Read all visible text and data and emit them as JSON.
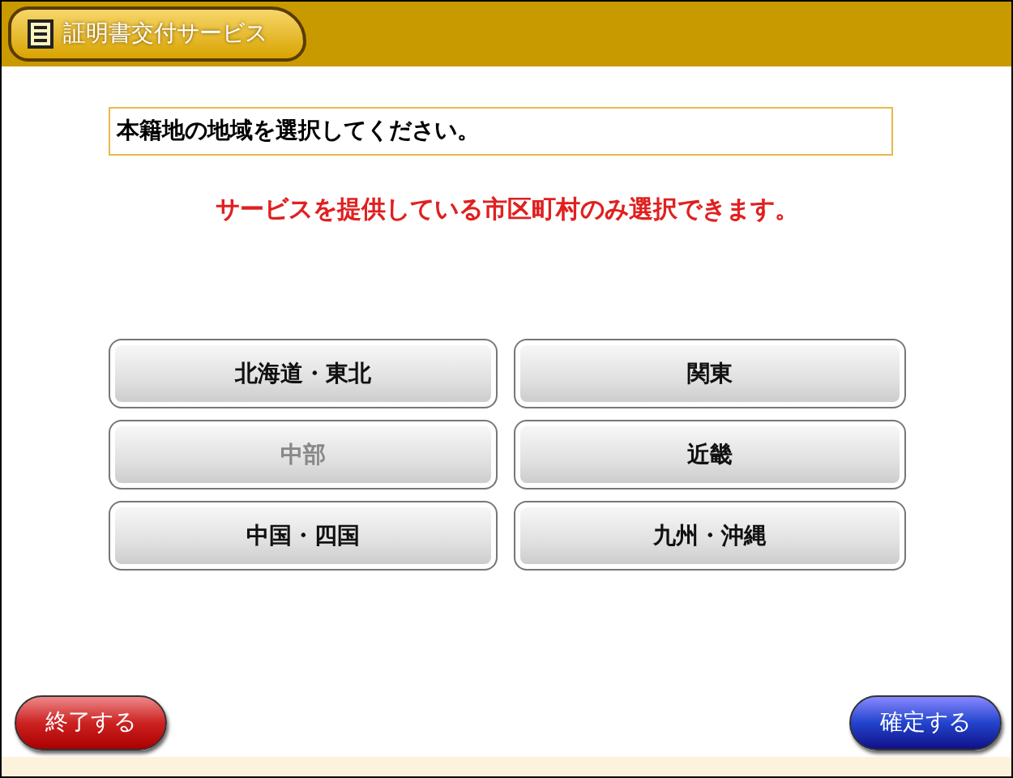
{
  "header": {
    "title": "証明書交付サービス"
  },
  "instruction": "本籍地の地域を選択してください。",
  "notice": "サービスを提供している市区町村のみ選択できます。",
  "regions": [
    {
      "label": "北海道・東北",
      "disabled": false
    },
    {
      "label": "関東",
      "disabled": false
    },
    {
      "label": "中部",
      "disabled": true
    },
    {
      "label": "近畿",
      "disabled": false
    },
    {
      "label": "中国・四国",
      "disabled": false
    },
    {
      "label": "九州・沖縄",
      "disabled": false
    }
  ],
  "buttons": [
    {
      "label": "終了する",
      "kind": "cancel"
    },
    {
      "label": "確定する",
      "kind": "confirm"
    }
  ]
}
